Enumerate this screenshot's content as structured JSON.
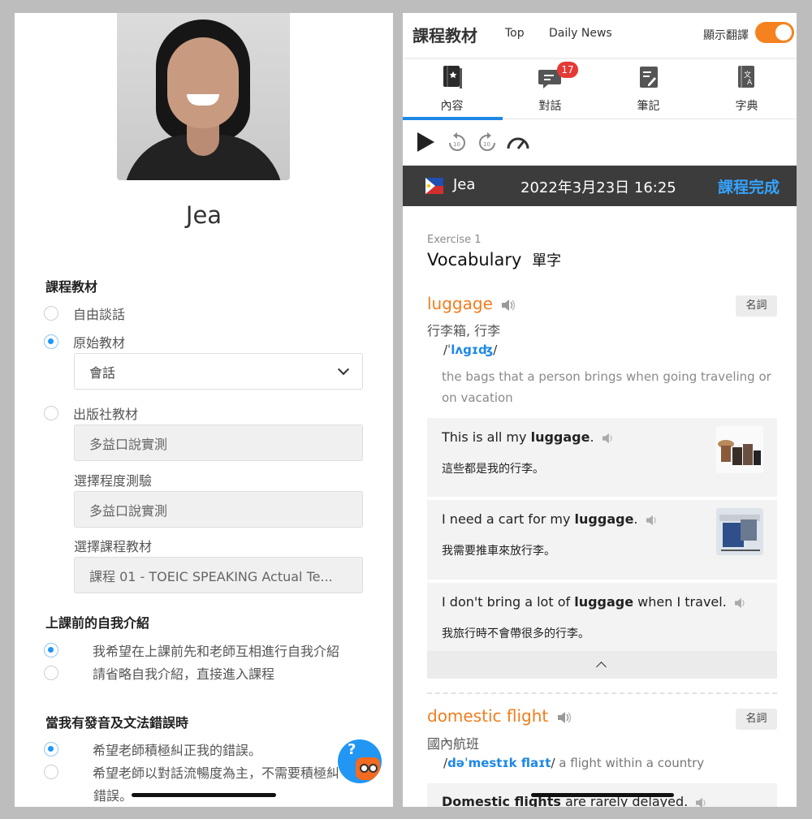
{
  "teacher": {
    "name": "Jea"
  },
  "settings": {
    "material_title": "課程教材",
    "options": [
      "自由談話",
      "原始教材",
      "出版社教材"
    ],
    "original_select": "會話",
    "publisher_select": "多益口說實測",
    "level_label": "選擇程度測驗",
    "level_select": "多益口說實測",
    "course_label": "選擇課程教材",
    "course_select": "課程 01 - TOEIC SPEAKING Actual Te...",
    "intro_title": "上課前的自我介紹",
    "intro_options": [
      "我希望在上課前先和老師互相進行自我介紹",
      "請省略自我介紹，直接進入課程"
    ],
    "error_title": "當我有發音及文法錯誤時",
    "error_options": [
      "希望老師積極糾正我的錯誤。",
      "希望老師以對話流暢度為主，不需要積極糾",
      "錯誤。"
    ]
  },
  "header": {
    "title": "課程教材",
    "links": [
      "Top",
      "Daily News"
    ],
    "translate_label": "顯示翻譯",
    "translate_on": true
  },
  "tabs": [
    {
      "label": "內容",
      "icon": "book-icon"
    },
    {
      "label": "對話",
      "icon": "chat-icon"
    },
    {
      "label": "筆記",
      "icon": "note-icon"
    },
    {
      "label": "字典",
      "icon": "dictionary-icon"
    }
  ],
  "chat_badge": "17",
  "lesson": {
    "teacher": "Jea",
    "datetime": "2022年3月23日 16:25",
    "status": "課程完成"
  },
  "exercise": {
    "label": "Exercise 1",
    "title": "Vocabulary",
    "title_zh": "單字"
  },
  "words": [
    {
      "word": "luggage",
      "pos": "名詞",
      "translation": "行李箱, 行李",
      "ipa_open": "/ˈ",
      "ipa": "lʌgɪʤ",
      "ipa_close": "/",
      "definition": "the bags that a person brings when going traveling or on vacation",
      "examples": [
        {
          "before": "This is all my ",
          "bold": "luggage",
          "after": ".",
          "zh": "這些都是我的行李。"
        },
        {
          "before": "I need a cart for my ",
          "bold": "luggage",
          "after": ".",
          "zh": "我需要推車來放行李。"
        },
        {
          "before": "I don't bring a lot of ",
          "bold": "luggage",
          "after": " when I travel.",
          "zh": "我旅行時不會帶很多的行李。"
        }
      ]
    },
    {
      "word": "domestic flight",
      "pos": "名詞",
      "translation": "國內航班",
      "ipa_open": "/",
      "ipa": "dəˈmestɪk flaɪt",
      "ipa_close": "/",
      "gloss": " a flight within a country",
      "example_partial": {
        "bold": "Domestic flights",
        "after": " are rarely delayed."
      }
    }
  ],
  "colors": {
    "accent_orange": "#f07d1b",
    "link_blue": "#1e88e5",
    "lesson_bar": "#3c3c3c",
    "toggle": "#f5821f"
  }
}
